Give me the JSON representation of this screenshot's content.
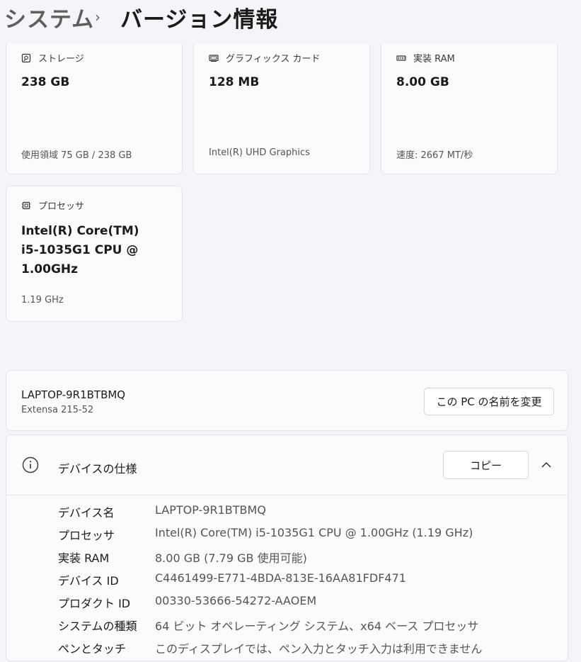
{
  "header": {
    "breadcrumb_parent": "システム",
    "breadcrumb_separator": "›",
    "page_title": "バージョン情報"
  },
  "cards": {
    "storage": {
      "label": "ストレージ",
      "value": "238 GB",
      "sub": "使用領域 75 GB / 238 GB",
      "icon": "storage-icon"
    },
    "graphics": {
      "label": "グラフィックス カード",
      "value": "128 MB",
      "sub": "Intel(R) UHD Graphics",
      "icon": "graphics-card-icon"
    },
    "ram": {
      "label": "実装 RAM",
      "value": "8.00 GB",
      "sub": "速度: 2667 MT/秒",
      "icon": "ram-icon"
    },
    "processor": {
      "label": "プロセッサ",
      "value_line1": "Intel(R) Core(TM)",
      "value_line2": "i5-1035G1 CPU @",
      "value_line3": "1.00GHz",
      "sub": "1.19 GHz",
      "icon": "processor-icon"
    }
  },
  "device": {
    "name": "LAPTOP-9R1BTBMQ",
    "model": "Extensa 215-52",
    "rename_label": "この PC の名前を変更"
  },
  "specs": {
    "title": "デバイスの仕様",
    "copy_label": "コピー",
    "rows": [
      {
        "key": "デバイス名",
        "value": "LAPTOP-9R1BTBMQ"
      },
      {
        "key": "プロセッサ",
        "value": "Intel(R) Core(TM) i5-1035G1 CPU @ 1.00GHz (1.19 GHz)"
      },
      {
        "key": "実装 RAM",
        "value": "8.00 GB (7.79 GB 使用可能)"
      },
      {
        "key": "デバイス ID",
        "value": "C4461499-E771-4BDA-813E-16AA81FDF471"
      },
      {
        "key": "プロダクト ID",
        "value": "00330-53666-54272-AAOEM"
      },
      {
        "key": "システムの種類",
        "value": "64 ビット オペレーティング システム、x64 ベース プロセッサ"
      },
      {
        "key": "ペンとタッチ",
        "value": "このディスプレイでは、ペン入力とタッチ入力は利用できません"
      }
    ]
  }
}
